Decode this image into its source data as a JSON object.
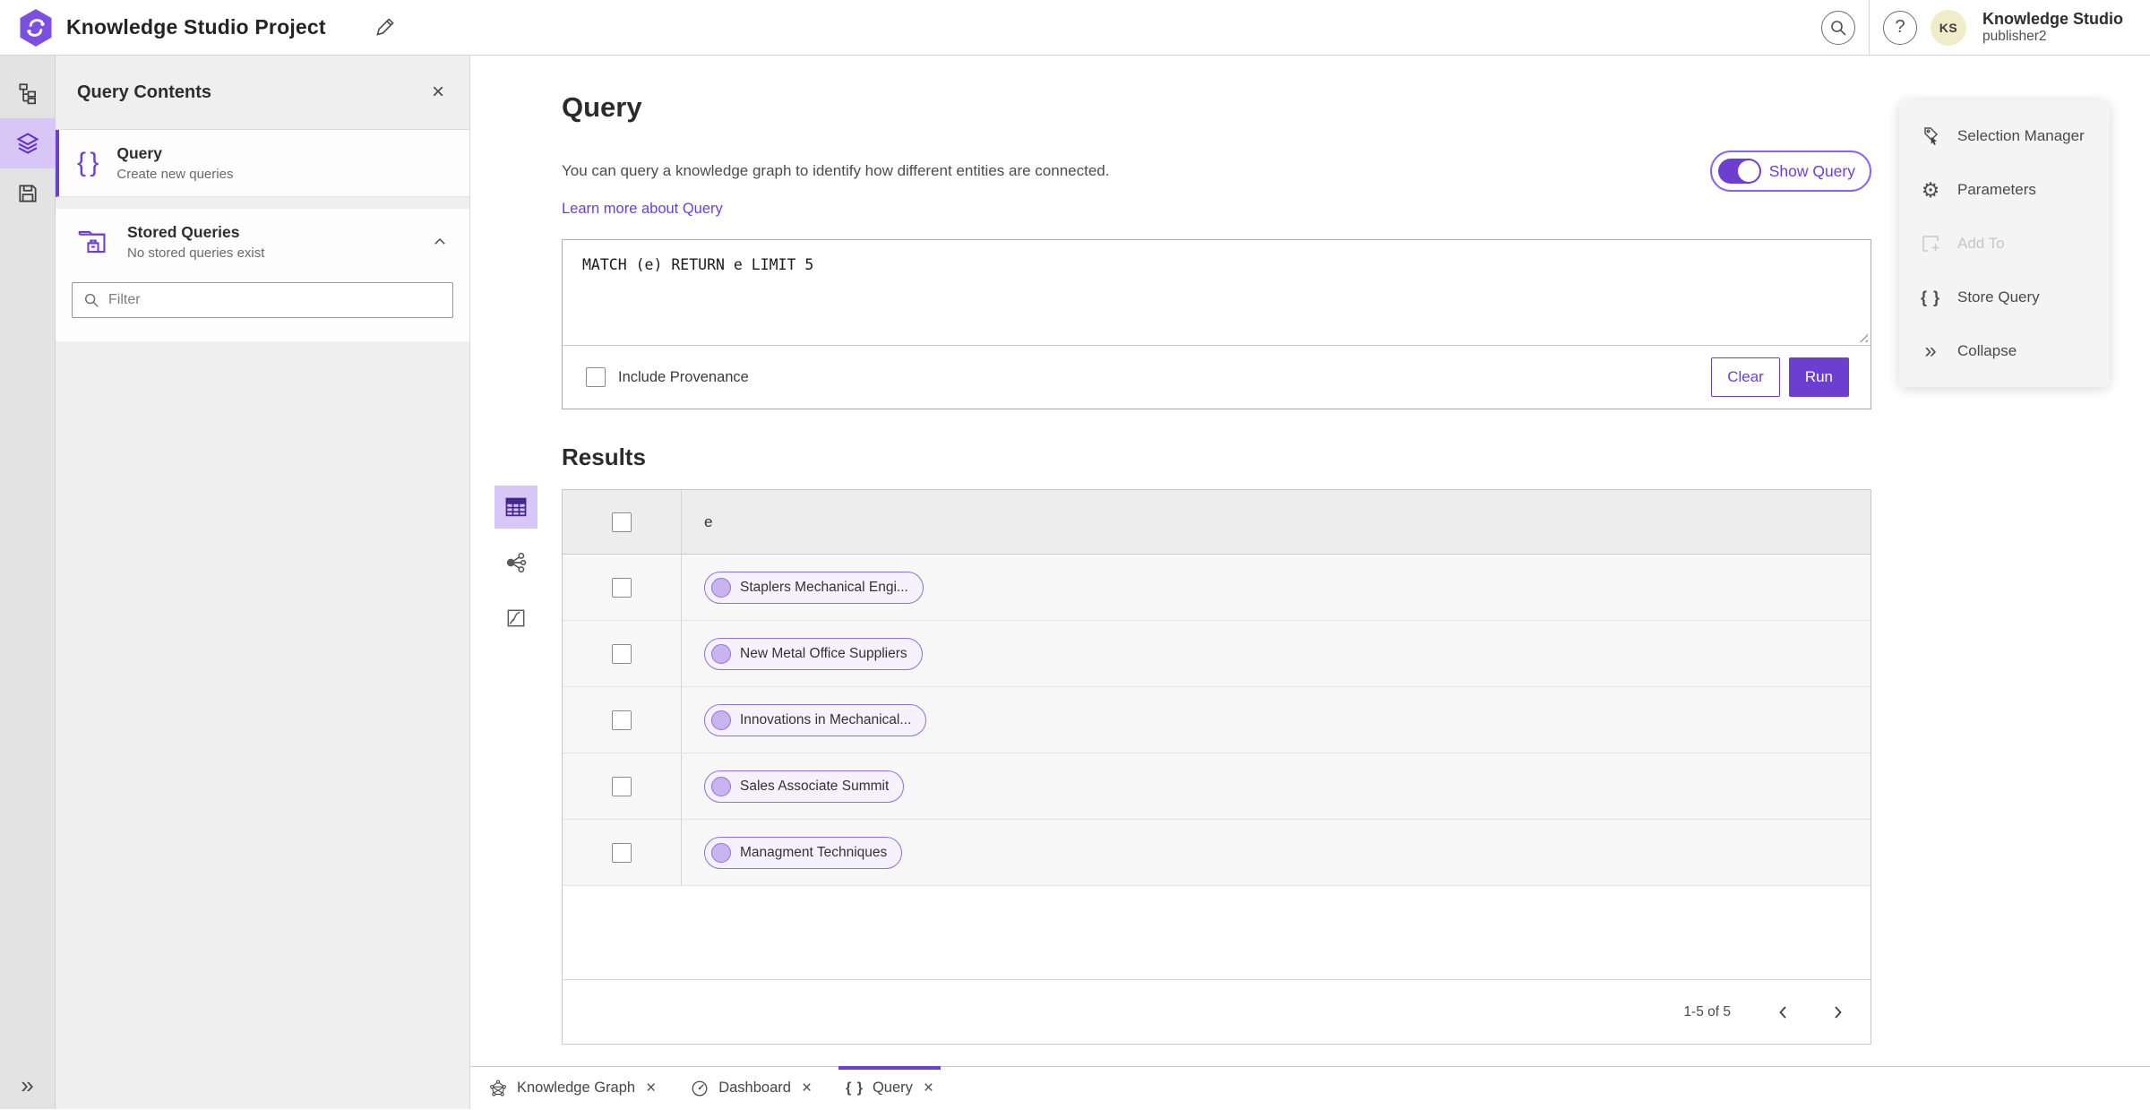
{
  "topbar": {
    "title": "Knowledge Studio Project",
    "user_name": "Knowledge Studio",
    "user_role": "publisher2",
    "avatar_initials": "KS"
  },
  "panel": {
    "title": "Query Contents",
    "items": [
      {
        "title": "Query",
        "subtitle": "Create new queries"
      },
      {
        "title": "Stored Queries",
        "subtitle": "No stored queries exist"
      }
    ],
    "filter_placeholder": "Filter"
  },
  "main": {
    "title": "Query",
    "description": "You can query a knowledge graph to identify how different entities are connected.",
    "link": "Learn more about Query",
    "toggle_label": "Show Query",
    "query_text": "MATCH (e) RETURN e LIMIT 5",
    "include_provenance": "Include Provenance",
    "clear_label": "Clear",
    "run_label": "Run",
    "results_title": "Results"
  },
  "table": {
    "column": "e",
    "rows": [
      "Staplers Mechanical Engi...",
      "New Metal Office Suppliers",
      "Innovations in Mechanical...",
      "Sales Associate Summit",
      "Managment Techniques"
    ],
    "pagination": "1-5 of 5"
  },
  "actions": [
    {
      "label": "Selection Manager"
    },
    {
      "label": "Parameters"
    },
    {
      "label": "Add To"
    },
    {
      "label": "Store Query"
    },
    {
      "label": "Collapse"
    }
  ],
  "tabs": [
    {
      "label": "Knowledge Graph"
    },
    {
      "label": "Dashboard"
    },
    {
      "label": "Query"
    }
  ],
  "icons": {
    "braces": "{ }",
    "gear": "⚙",
    "collapse": "»",
    "expand": "»",
    "close": "×",
    "help": "?"
  },
  "colors": {
    "accent": "#6d3fd1",
    "accentSoft": "#d8c6f6",
    "pillBg": "#f5f1fd",
    "pillBorder": "#8f72e0",
    "pillDot": "#c9b4ef",
    "panelBg": "#efeff0",
    "railBg": "#e3e3e4",
    "cardBg": "#f4f4f5",
    "headerBg": "#ededed",
    "rowBg": "#f7f7f8",
    "avatarBg": "#f0ecca"
  }
}
